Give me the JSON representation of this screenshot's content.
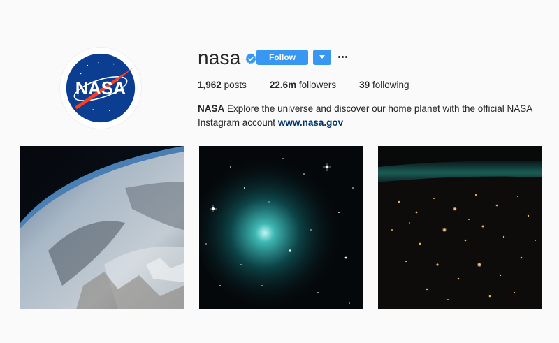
{
  "profile": {
    "username": "nasa",
    "logo_text": "NASA",
    "follow_label": "Follow",
    "dropdown_icon": "caret-down-icon",
    "more_icon": "ellipsis-icon",
    "verified_icon": "verified-badge-icon"
  },
  "stats": [
    {
      "value": "1,962",
      "label": "posts"
    },
    {
      "value": "22.6m",
      "label": "followers"
    },
    {
      "value": "39",
      "label": "following"
    }
  ],
  "bio": {
    "name": "NASA",
    "text": "Explore the universe and discover our home planet with the official NASA Instagram account",
    "link": "www.nasa.gov"
  },
  "colors": {
    "accent": "#3897f0",
    "background": "#fafafa",
    "link": "#003569",
    "nasa_blue": "#0b3d91",
    "nasa_red": "#fc3d21"
  }
}
